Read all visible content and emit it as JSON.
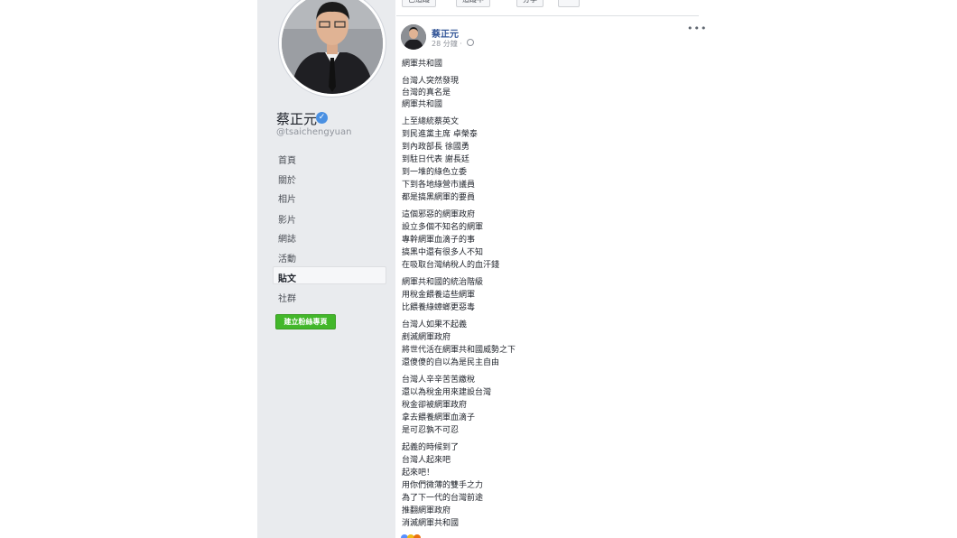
{
  "page": {
    "name": "蔡正元",
    "handle": "@tsaichengyuan",
    "verified_icon": "verified-check-icon"
  },
  "top_bar": {
    "buttons": [
      "已追蹤",
      "追蹤中",
      "分享"
    ]
  },
  "nav": {
    "items": [
      "首頁",
      "關於",
      "相片",
      "影片",
      "網誌",
      "活動",
      "貼文",
      "社群"
    ],
    "active": "貼文",
    "create_button": "建立粉絲專頁"
  },
  "post": {
    "author": "蔡正元",
    "time": "28 分鐘 · ",
    "privacy_icon": "globe-icon",
    "more_icon": "more-options-icon",
    "lines": [
      "網軍共和國",
      "台灣人突然發現",
      "台灣的真名是",
      "網軍共和國",
      "上至總統蔡英文",
      "到民進黨主席 卓榮泰",
      "到內政部長 徐國勇",
      "到駐日代表 謝長廷",
      "到一堆的綠色立委",
      "下到各地綠營市議員",
      "都是搞黑網軍的要員",
      "這個邪惡的網軍政府",
      "設立多個不知名的網軍",
      "專幹網軍血滴子的事",
      "搞黑中還有很多人不知",
      "在吸取台灣納稅人的血汗錢",
      "網軍共和國的統治階級",
      "用稅金餵養這些網軍",
      "比餵養綠蟑螂更惡毒",
      "台灣人如果不起義",
      "剷滅網軍政府",
      "將世代活在網軍共和國威勢之下",
      "還傻傻的自以為是民主自由",
      "台灣人辛辛苦苦繳稅",
      "還以為稅金用來建設台灣",
      "稅金卻被網軍政府",
      "拿去餵養網軍血滴子",
      "是可忍孰不可忍",
      "起義的時候到了",
      "台灣人起來吧",
      "起來吧！",
      "用你們微薄的雙手之力",
      "為了下一代的台灣前途",
      "推翻網軍政府",
      "消滅網軍共和國"
    ]
  }
}
